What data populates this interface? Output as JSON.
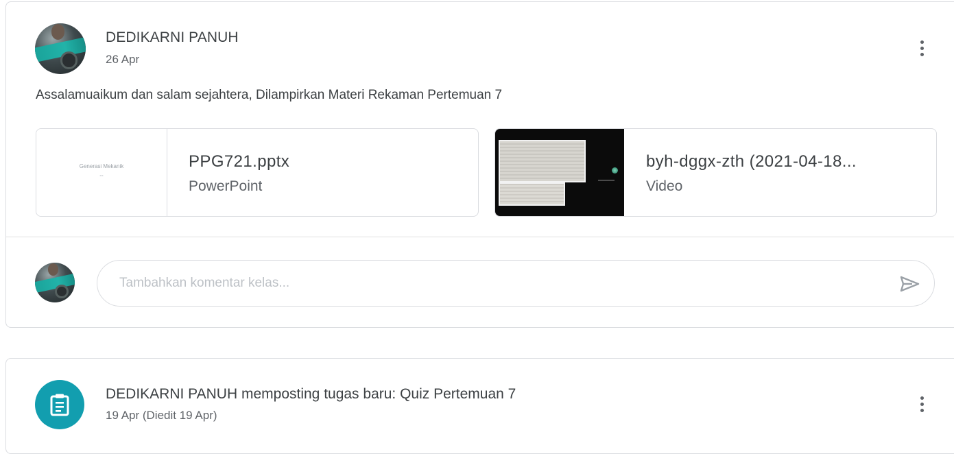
{
  "post": {
    "author": "DEDIKARNI PANUH",
    "date": "26 Apr",
    "text": "Assalamuaikum dan salam sejahtera, Dilampirkan Materi Rekaman Pertemuan 7",
    "attachments": [
      {
        "title": "PPG721.pptx",
        "type": "PowerPoint",
        "thumbnail_text": "Generasi Mekanik",
        "thumbnail_icon": "slide-thumbnail"
      },
      {
        "title": "byh-dggx-zth (2021-04-18...",
        "type": "Video",
        "thumbnail_icon": "video-thumbnail"
      }
    ],
    "comment": {
      "placeholder": "Tambahkan komentar kelas...",
      "value": "",
      "send_icon": "send-icon"
    },
    "more_icon": "more-vert-icon"
  },
  "assignment": {
    "title": "DEDIKARNI PANUH memposting tugas baru: Quiz Pertemuan 7",
    "date": "19 Apr (Diedit 19 Apr)",
    "icon": "assignment-icon",
    "more_icon": "more-vert-icon"
  },
  "colors": {
    "accent": "#129eaf",
    "border": "#dadce0",
    "text": "#3c4043",
    "secondary_text": "#5f6368"
  }
}
